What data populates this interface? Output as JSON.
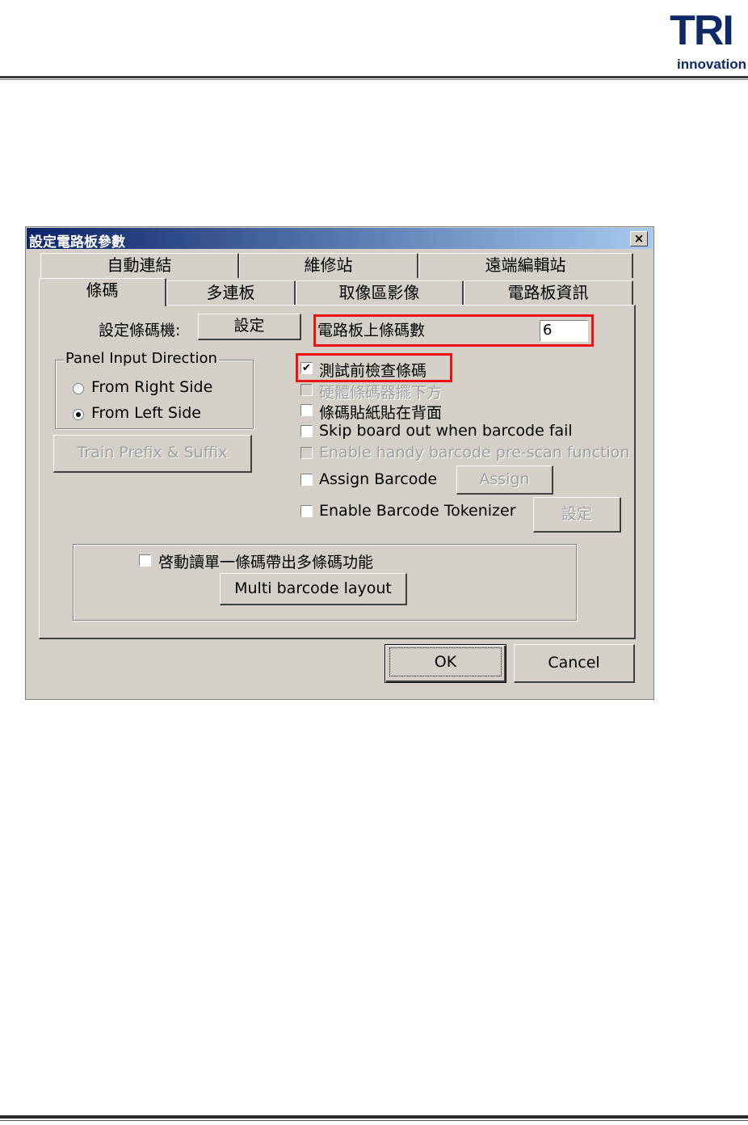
{
  "logo": {
    "text": "TRI",
    "sub": "innovation"
  },
  "dialog": {
    "title": "設定電路板參數",
    "close": "×",
    "tabs_back": [
      "自動連結",
      "維修站",
      "遠端編輯站"
    ],
    "tabs_front": [
      "條碼",
      "多連板",
      "取像區影像",
      "電路板資訊"
    ],
    "barcode_device_label": "設定條碼機:",
    "barcode_device_button": "設定",
    "barcode_count_label": "電路板上條碼數",
    "barcode_count_value": "6",
    "panel_direction": {
      "legend": "Panel Input Direction",
      "options": [
        "From Right Side",
        "From Left Side"
      ],
      "selected": "From Left Side"
    },
    "train_button": "Train Prefix & Suffix",
    "checkboxes": [
      {
        "label": "測試前檢查條碼",
        "checked": true,
        "enabled": true
      },
      {
        "label": "硬體條碼器擺下方",
        "checked": false,
        "enabled": false
      },
      {
        "label": "條碼貼紙貼在背面",
        "checked": false,
        "enabled": true
      },
      {
        "label": "Skip board out when barcode fail",
        "checked": false,
        "enabled": true
      },
      {
        "label": "Enable handy barcode pre-scan function",
        "checked": false,
        "enabled": false
      },
      {
        "label": "Assign Barcode",
        "checked": false,
        "enabled": true
      },
      {
        "label": "Enable Barcode Tokenizer",
        "checked": false,
        "enabled": true
      }
    ],
    "assign_button": "Assign",
    "tokenizer_button": "設定",
    "multi": {
      "label": "啓動讀單一條碼帶出多條碼功能",
      "button": "Multi barcode layout"
    },
    "ok": "OK",
    "cancel": "Cancel",
    "check_mark": "✔"
  }
}
